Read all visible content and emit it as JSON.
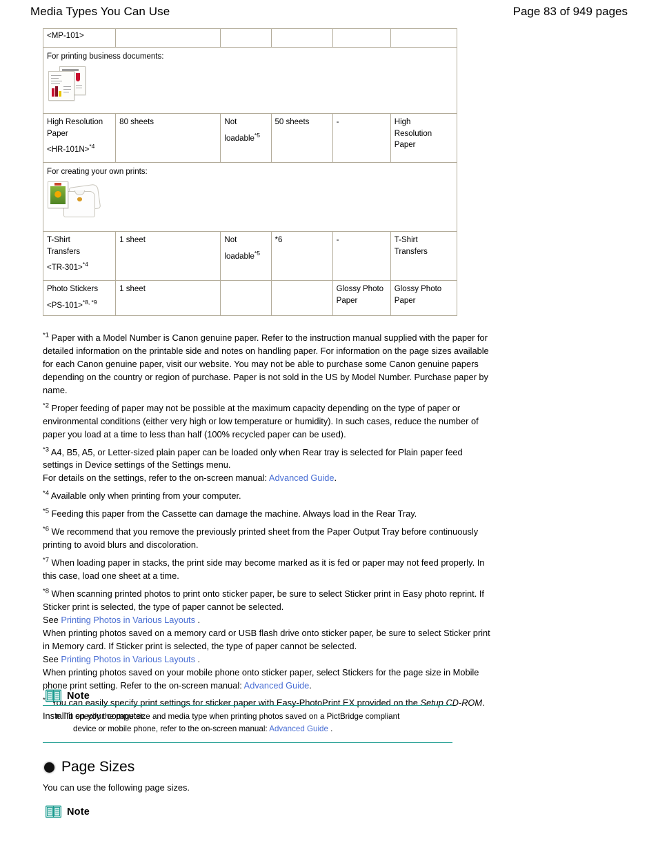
{
  "header": {
    "title": "Media Types You Can Use",
    "page_number": "Page 83 of 949 pages"
  },
  "table": {
    "rows": [
      {
        "type": "spec",
        "name_line1": "",
        "name_line2": "",
        "model": "<MP-101>",
        "rear_tray": "",
        "cassette": "",
        "output_tray": "",
        "driver_media": "",
        "lcd_media": ""
      },
      {
        "type": "description",
        "label": "For printing business documents:",
        "thumbnail": "business-document-thumbnail"
      },
      {
        "type": "spec",
        "name_line1": "High Resolution",
        "name_line2": "Paper",
        "model": "<HR-101N>",
        "model_sup": "*4",
        "rear_tray": "80 sheets",
        "cassette_line1": "Not",
        "cassette_line2": "loadable",
        "cassette_sup": "*5",
        "output_tray": "50 sheets",
        "driver_media": "-",
        "lcd_media_line1": "High",
        "lcd_media_line2": "Resolution",
        "lcd_media_line3": "Paper"
      },
      {
        "type": "description",
        "label": "For creating your own prints:",
        "thumbnail": "tshirt-transfer-thumbnail"
      },
      {
        "type": "spec",
        "name_line1": "T-Shirt",
        "name_line2": "Transfers",
        "model": "<TR-301>",
        "model_sup": "*4",
        "rear_tray": "1 sheet",
        "cassette_line1": "Not",
        "cassette_line2": "loadable",
        "cassette_sup": "*5",
        "output_tray": "*6",
        "driver_media": "-",
        "lcd_media_line1": "T-Shirt",
        "lcd_media_line2": "Transfers"
      },
      {
        "type": "spec",
        "name_line1": "Photo Stickers",
        "name_line2": "",
        "model": "<PS-101>",
        "model_sup": "*8, *9",
        "rear_tray": "1 sheet",
        "cassette_line1": "",
        "cassette_line2": "",
        "output_tray": "",
        "driver_media_line1": "Glossy Photo",
        "driver_media_line2": "Paper",
        "lcd_media_line1": "Glossy Photo",
        "lcd_media_line2": "Paper"
      }
    ]
  },
  "footnotes": {
    "f1_marker": "*1",
    "f1_text": " Paper with a Model Number is Canon genuine paper. Refer to the instruction manual supplied with the paper for detailed information on the printable side and notes on handling paper. For information on the page sizes available for each Canon genuine paper, visit our website. You may not be able to purchase some Canon genuine papers depending on the country or region of purchase. Paper is not sold in the US by Model Number. Purchase paper by name.",
    "f2_marker": "*2",
    "f2_text": " Proper feeding of paper may not be possible at the maximum capacity depending on the type of paper or environmental conditions (either very high or low temperature or humidity). In such cases, reduce the number of paper you load at a time to less than half (100% recycled paper can be used).",
    "f3_marker": "*3",
    "f3_text": " A4, B5, A5, or Letter-sized plain paper can be loaded only when Rear tray is selected for Plain paper feed settings in Device settings of the Settings menu.",
    "f3_line2_prefix": "For details on the settings, refer to the on-screen manual: ",
    "f3_link": "Advanced Guide",
    "f3_line2_suffix": ".",
    "f4_marker": "*4",
    "f4_text": " Available only when printing from your computer.",
    "f5_marker": "*5",
    "f5_text": " Feeding this paper from the Cassette can damage the machine. Always load in the Rear Tray.",
    "f6_marker": "*6",
    "f6_text": " We recommend that you remove the previously printed sheet from the Paper Output Tray before continuously printing to avoid blurs and discoloration.",
    "f7_marker": "*7",
    "f7_text": " When loading paper in stacks, the print side may become marked as it is fed or paper may not feed properly. In this case, load one sheet at a time.",
    "f8_marker": "*8",
    "f8_text": " When scanning printed photos to print onto sticker paper, be sure to select Sticker print in Easy photo reprint. If Sticker print is selected, the type of paper cannot be selected.",
    "f8_see_prefix": "See ",
    "f8_link": "Printing Photos in Various Layouts",
    "f8_see_suffix": " .",
    "f8_text2": "When printing photos saved on a memory card or USB flash drive onto sticker paper, be sure to select Sticker print in Memory card. If Sticker print is selected, the type of paper cannot be selected.",
    "f8_see2_prefix": "See ",
    "f8_link2": "Printing Photos in Various Layouts",
    "f8_see2_suffix": " .",
    "f8_text3_prefix": "When printing photos saved on your mobile phone onto sticker paper, select Stickers for the page size in Mobile phone print setting. Refer to the on-screen manual: ",
    "f8_link3": "Advanced Guide",
    "f8_text3_suffix": ".",
    "f9_marker": "*9",
    "f9_text_prefix": " You can easily specify print settings for sticker paper with Easy-PhotoPrint EX provided on the ",
    "f9_italic": "Setup CD-ROM",
    "f9_text_suffix": ". Install it on your computer."
  },
  "note1": {
    "label": "Note",
    "body_line1": "To specify the page size and media type when printing photos saved on a PictBridge compliant",
    "body_line2_prefix": "device or mobile phone, refer to the on-screen manual: ",
    "body_link": "Advanced Guide",
    "body_line2_suffix": " ."
  },
  "page_sizes": {
    "heading": "Page Sizes",
    "subtext": "You can use the following page sizes."
  },
  "note2": {
    "label": "Note"
  },
  "colors": {
    "link": "#4a6fd4",
    "note_accent": "#1a9b8f",
    "table_border": "#b3ac9a"
  }
}
